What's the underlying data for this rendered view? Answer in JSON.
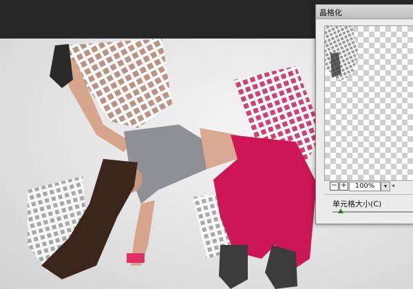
{
  "dialog": {
    "title": "晶格化",
    "zoom": {
      "minus_label": "−",
      "plus_label": "+",
      "value": "100%",
      "dropdown_icon": "chevron-down-icon"
    },
    "cell_size": {
      "label": "单元格大小(C)",
      "slider_level": 0.07
    }
  },
  "canvas": {
    "image_description_icon": "photo-dancer-crystallize"
  },
  "colors": {
    "topbar": "#262626",
    "dialog_bg": "#ececec",
    "pants": "#cc1655",
    "shirt": "#8e9095",
    "slider_thumb": "#2a7a2a"
  }
}
